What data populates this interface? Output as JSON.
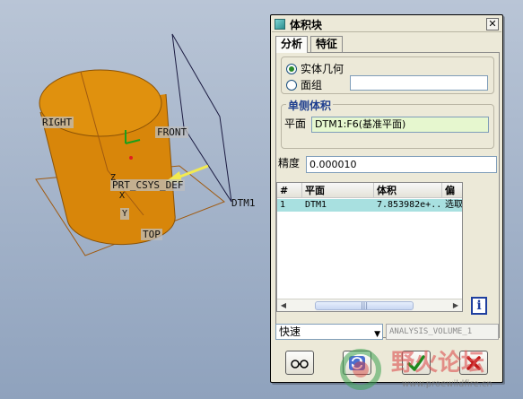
{
  "viewport": {
    "labels": {
      "right": "RIGHT",
      "front": "FRONT",
      "csys": "PRT_CSYS_DEF",
      "dtm1": "DTM1",
      "top": "TOP",
      "x_axis": "X",
      "y_axis": "Y",
      "z_axis": "Z"
    }
  },
  "dialog": {
    "title": "体积块",
    "close_label": "✕",
    "tabs": [
      {
        "label": "分析",
        "active": true
      },
      {
        "label": "特征",
        "active": false
      }
    ],
    "geometry_options": [
      {
        "label": "实体几何",
        "selected": true
      },
      {
        "label": "面组",
        "selected": false
      }
    ],
    "quilt_value": "",
    "one_sided": {
      "legend": "单侧体积",
      "plane_label": "平面",
      "plane_value": "DTM1:F6(基准平面)"
    },
    "precision": {
      "label": "精度",
      "value": "0.000010"
    },
    "results": {
      "columns": [
        "#",
        "平面",
        "体积",
        "偏"
      ],
      "rows": [
        {
          "index": "1",
          "plane": "DTM1",
          "volume": "7.853982e+...",
          "side": "选取"
        }
      ]
    },
    "mode": {
      "selected": "快速"
    },
    "analysis_name": "ANALYSIS_VOLUME_1",
    "buttons": {
      "glasses": "glasses-icon",
      "repeat": "repeat-icon",
      "ok": "checkmark-icon",
      "cancel": "cross-icon"
    }
  },
  "watermark": {
    "text": "野火论坛",
    "url": "www.proewildfire.cn"
  },
  "colors": {
    "model_orange": "#d8860a",
    "dialog_bg": "#ece9d8",
    "accent_blue": "#1f3f8f",
    "selected_row": "#a8e0e0",
    "field_green": "#e6f7cf"
  }
}
